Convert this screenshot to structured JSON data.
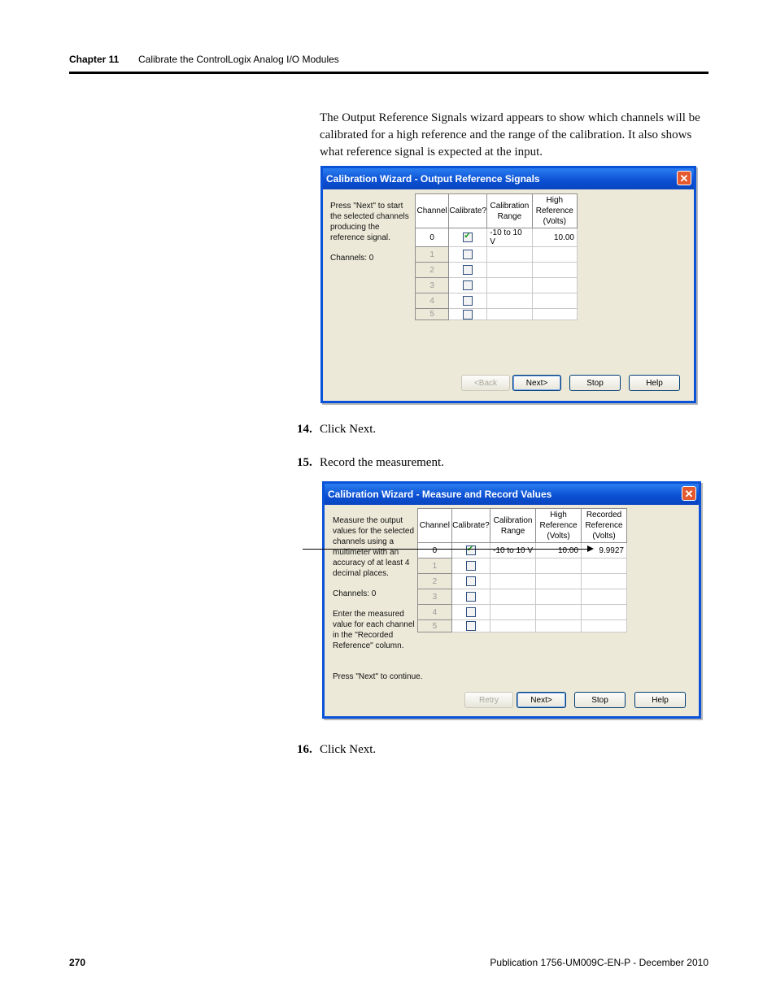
{
  "header": {
    "chapter": "Chapter 11",
    "title": "Calibrate the ControlLogix Analog I/O Modules"
  },
  "intro": "The Output Reference Signals wizard appears to show which channels will be calibrated for a high reference and the range of the calibration. It also shows what reference signal is expected at the input.",
  "dialog1": {
    "title": "Calibration Wizard - Output Reference Signals",
    "instructions": "Press \"Next\" to start the selected channels producing the reference signal.",
    "channels_text": "Channels: 0",
    "columns": [
      "Channel",
      "Calibrate?",
      "Calibration Range",
      "High Reference (Volts)"
    ],
    "rows": [
      {
        "channel": "0",
        "checked": true,
        "range": "-10 to 10 V",
        "high": "10.00"
      },
      {
        "channel": "1",
        "checked": false,
        "range": "",
        "high": ""
      },
      {
        "channel": "2",
        "checked": false,
        "range": "",
        "high": ""
      },
      {
        "channel": "3",
        "checked": false,
        "range": "",
        "high": ""
      },
      {
        "channel": "4",
        "checked": false,
        "range": "",
        "high": ""
      },
      {
        "channel": "5",
        "checked": false,
        "range": "",
        "high": ""
      }
    ],
    "buttons": {
      "back": "<Back",
      "next": "Next>",
      "stop": "Stop",
      "help": "Help"
    }
  },
  "steps": {
    "s14_num": "14.",
    "s14": "Click Next.",
    "s15_num": "15.",
    "s15": "Record the measurement.",
    "s16_num": "16.",
    "s16": "Click Next."
  },
  "dialog2": {
    "title": "Calibration Wizard - Measure and Record Values",
    "instructions": "Measure the output values for the selected channels using a multimeter with an accuracy of at least 4 decimal places.",
    "channels_text": "Channels: 0",
    "instructions2": "Enter the measured value for each channel in the \"Recorded Reference\" column.",
    "instructions3": "Press \"Next\" to continue.",
    "columns": [
      "Channel",
      "Calibrate?",
      "Calibration Range",
      "High Reference (Volts)",
      "Recorded Reference (Volts)"
    ],
    "rows": [
      {
        "channel": "0",
        "checked": true,
        "range": "-10 to 10 V",
        "high": "10.00",
        "recorded": "9.9927"
      },
      {
        "channel": "1",
        "checked": false,
        "range": "",
        "high": "",
        "recorded": ""
      },
      {
        "channel": "2",
        "checked": false,
        "range": "",
        "high": "",
        "recorded": ""
      },
      {
        "channel": "3",
        "checked": false,
        "range": "",
        "high": "",
        "recorded": ""
      },
      {
        "channel": "4",
        "checked": false,
        "range": "",
        "high": "",
        "recorded": ""
      },
      {
        "channel": "5",
        "checked": false,
        "range": "",
        "high": "",
        "recorded": ""
      }
    ],
    "buttons": {
      "retry": "Retry",
      "next": "Next>",
      "stop": "Stop",
      "help": "Help"
    }
  },
  "footer": {
    "page": "270",
    "publication": "Publication 1756-UM009C-EN-P - December 2010"
  },
  "colors": {
    "title_bar": "#0b4fd2",
    "dialog_bg": "#ece9d8",
    "close": "#e45a2e",
    "check": "#1a9e1a"
  }
}
